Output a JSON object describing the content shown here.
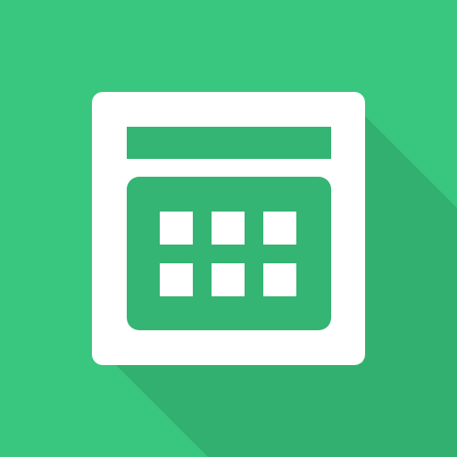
{
  "icon": {
    "name": "calendar-app-icon",
    "colors": {
      "background": "#39c67f",
      "long_shadow": "#32b06f",
      "frame": "#ffffff",
      "panel": "#34b573",
      "cells": "#ffffff"
    },
    "grid": {
      "rows": 2,
      "columns": 3
    }
  }
}
